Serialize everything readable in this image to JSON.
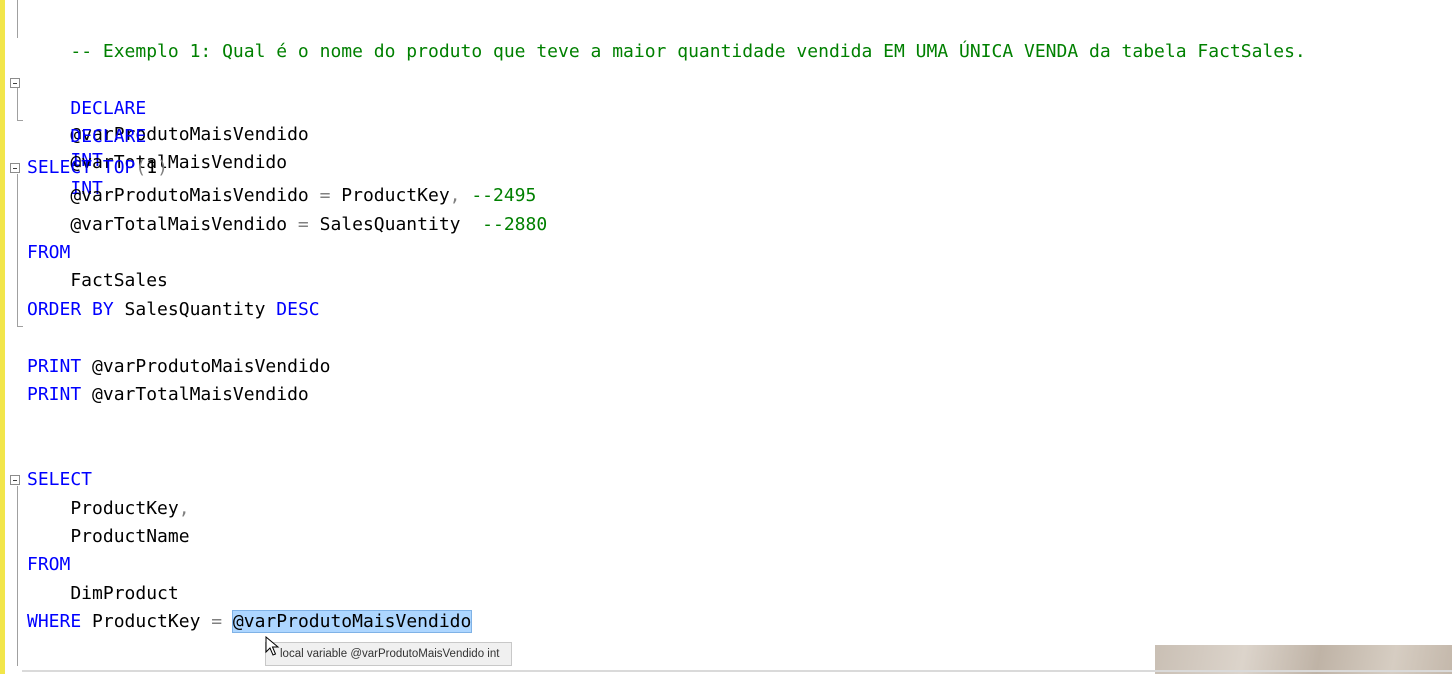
{
  "code": {
    "comment_line": "-- Exemplo 1: Qual é o nome do produto que teve a maior quantidade vendida EM UMA ÚNICA VENDA da tabela FactSales.",
    "kw_declare": "DECLARE",
    "var_produto": "@varProdutoMaisVendido",
    "var_total": "@varTotalMaisVendido",
    "kw_int": "INT",
    "kw_select": "SELECT",
    "kw_top": "TOP",
    "paren_open": "(",
    "top_value": "1",
    "paren_close": ")",
    "indent_var_produto": "    @varProdutoMaisVendido",
    "indent_var_total": "    @varTotalMaisVendido",
    "equals": " = ",
    "col_productkey": "ProductKey",
    "comma": ",",
    "comment_2495": " --2495",
    "col_salesquantity": "SalesQuantity",
    "comment_2880": "  --2880",
    "kw_from": "FROM",
    "indent_factsales": "    FactSales",
    "kw_order_by": "ORDER BY",
    "kw_desc": "DESC",
    "kw_print": "PRINT",
    "indent_productkey": "    ProductKey",
    "indent_productname": "    ProductName",
    "indent_dimproduct": "    DimProduct",
    "kw_where": "WHERE",
    "selected_variable": "@varProdutoMaisVendido"
  },
  "tooltip": {
    "text": "local variable @varProdutoMaisVendido int"
  },
  "colors": {
    "keyword": "#0000ff",
    "comment": "#008000",
    "operator": "#808080",
    "selection": "#add6ff",
    "change_margin": "#f2e64a"
  }
}
